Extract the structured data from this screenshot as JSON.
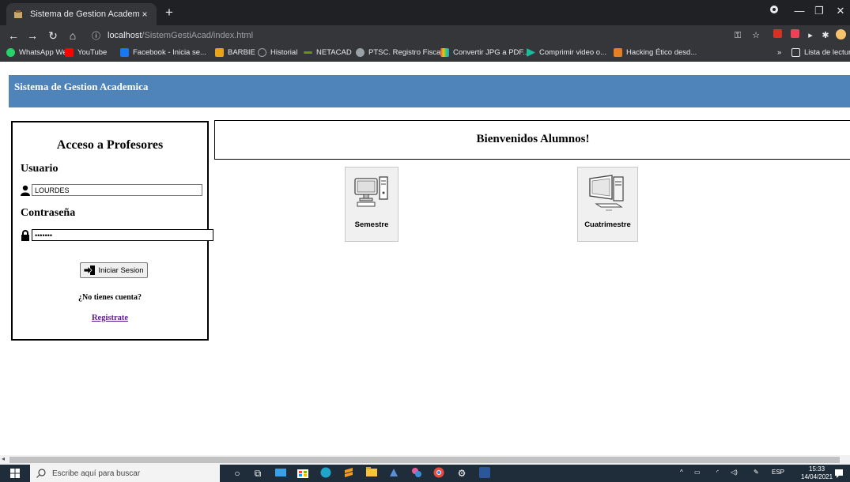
{
  "browser": {
    "tab_title": "Sistema de Gestion Academica",
    "tab_close": "×",
    "new_tab": "+",
    "url_host": "localhost",
    "url_path": "/SistemGestiAcad/index.html",
    "bookmarks": [
      {
        "label": "WhatsApp Web",
        "color": "#25d366"
      },
      {
        "label": "YouTube",
        "color": "#ff0000"
      },
      {
        "label": "Facebook - Inicia se...",
        "color": "#1877f2"
      },
      {
        "label": "BARBIE",
        "color": "#e8a317"
      },
      {
        "label": "Historial",
        "color": "#9aa0a6"
      },
      {
        "label": "NETACAD",
        "color": "#6b8e23"
      },
      {
        "label": "PTSC. Registro Fisca...",
        "color": "#9aa0a6"
      },
      {
        "label": "Convertir JPG a PDF...",
        "color": "#e74c3c"
      },
      {
        "label": "Comprimir video o...",
        "color": "#1abc9c"
      },
      {
        "label": "Hacking Ético desd...",
        "color": "#e67e22"
      }
    ],
    "more_bookmarks": "»",
    "reading_list": "Lista de lectura"
  },
  "page": {
    "banner_title": "Sistema de Gestion Academica",
    "login": {
      "heading": "Acceso a Profesores",
      "user_label": "Usuario",
      "user_value": "LOURDES",
      "password_label": "Contraseña",
      "password_value": "•••••••",
      "submit_label": "Iniciar Sesion",
      "no_account": "¿No tienes cuenta?",
      "register_link": "Registrate"
    },
    "welcome": "Bienvenidos Alumnos!",
    "tiles": [
      {
        "label": "Semestre",
        "icon": "computer-icon"
      },
      {
        "label": "Cuatrimestre",
        "icon": "computer-icon"
      }
    ]
  },
  "taskbar": {
    "search_placeholder": "Escribe aquí para buscar",
    "lang": "ESP",
    "time": "15:33",
    "date": "14/04/2021"
  },
  "colors": {
    "banner": "#4f84bb",
    "chrome_dark": "#202124",
    "chrome_toolbar": "#35363a",
    "link_visited": "#551a8b",
    "taskbar": "#1f2d3a"
  }
}
